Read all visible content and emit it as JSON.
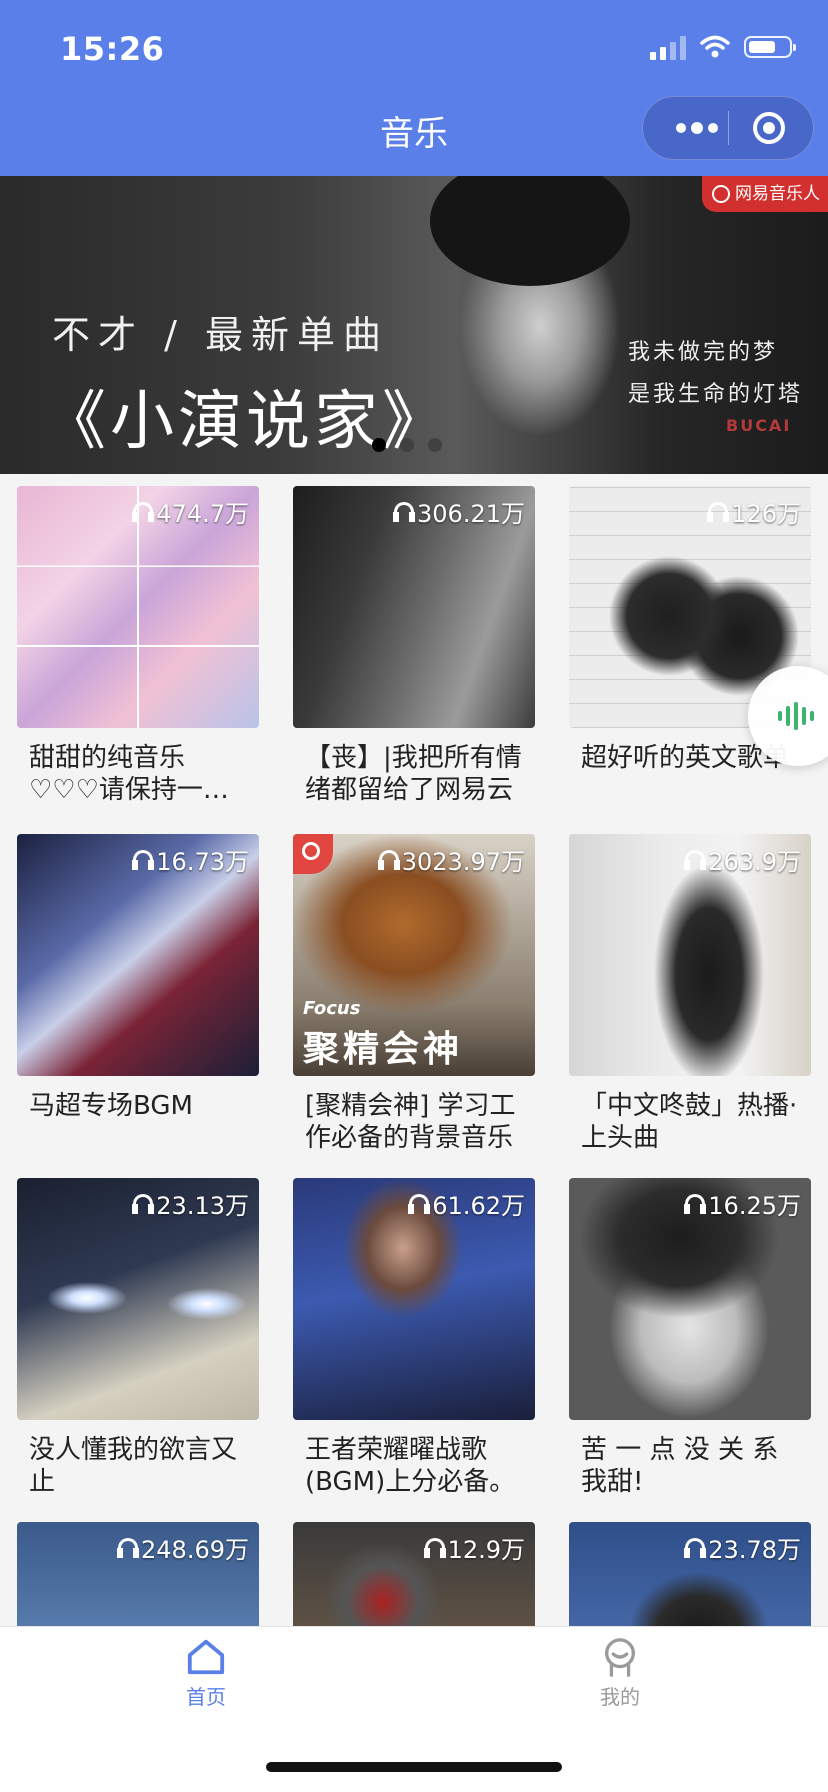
{
  "status_bar": {
    "time": "15:26"
  },
  "header": {
    "title": "音乐"
  },
  "colors": {
    "header_bg": "#5a7fe8",
    "tab_active": "#5a7fe8",
    "tab_inactive": "#9a9a9a",
    "accent_red": "#d2302f"
  },
  "banner": {
    "tag": "网易音乐人",
    "subtitle": "不才 / 最新单曲",
    "title": "《小演说家》",
    "poem_line1": "我未做完的梦",
    "poem_line2": "是我生命的灯塔",
    "signature": "BUCAI",
    "slide_count": 3,
    "active_slide": 1
  },
  "playlists": [
    {
      "title": "甜甜的纯音乐♡♡♡请保持一…",
      "count": "474.7万",
      "icon": "headphone-icon"
    },
    {
      "title": "【丧】|我把所有情绪都留给了网易云",
      "count": "306.21万",
      "icon": "headphone-icon"
    },
    {
      "title": "超好听的英文歌单",
      "count": "126万",
      "icon": "headphone-icon"
    },
    {
      "title": "马超专场BGM",
      "count": "16.73万",
      "icon": "headphone-icon"
    },
    {
      "title": "[聚精会神] 学习工作必备的背景音乐",
      "count": "3023.97万",
      "icon": "headphone-icon",
      "caption_en": "Focus",
      "caption": "聚精会神"
    },
    {
      "title": "「中文咚鼓」热播·上头曲",
      "count": "263.9万",
      "icon": "headphone-icon"
    },
    {
      "title": "没人懂我的欲言又止",
      "count": "23.13万",
      "icon": "headphone-icon"
    },
    {
      "title": "王者荣耀曜战歌(BGM)上分必备。",
      "count": "61.62万",
      "icon": "headphone-icon"
    },
    {
      "title": "苦 一 点 没 关 系 我甜!",
      "count": "16.25万",
      "icon": "headphone-icon"
    },
    {
      "title": "",
      "count": "248.69万",
      "icon": "headphone-icon"
    },
    {
      "title": "",
      "count": "12.9万",
      "icon": "headphone-icon"
    },
    {
      "title": "",
      "count": "23.78万",
      "icon": "headphone-icon"
    }
  ],
  "tabbar": {
    "home_label": "首页",
    "mine_label": "我的",
    "active": "home"
  }
}
